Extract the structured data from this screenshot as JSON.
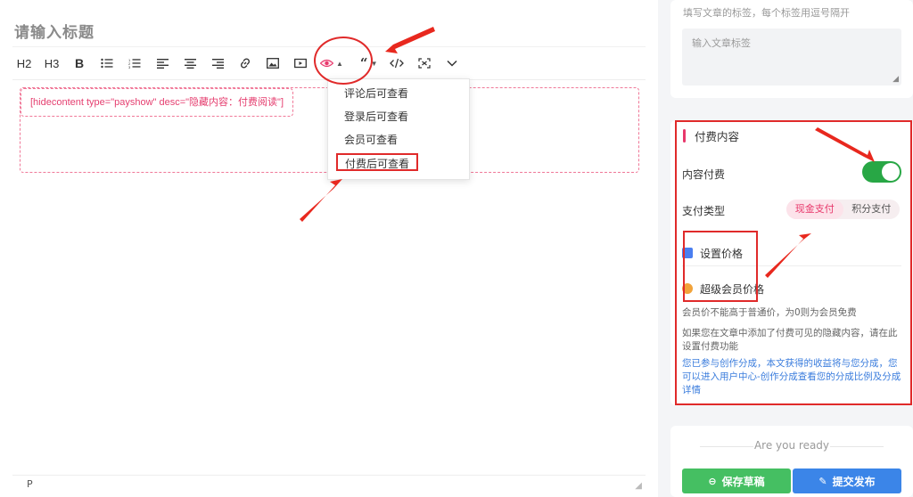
{
  "editor": {
    "title_placeholder": "请输入标题",
    "toolbar": {
      "h2": "H2",
      "h3": "H3",
      "bold": "B",
      "icons": [
        "unordered-list-icon",
        "ordered-list-icon",
        "align-left-icon",
        "align-center-icon",
        "align-right-icon",
        "link-icon",
        "image-icon",
        "video-icon",
        "eye-icon",
        "quote-icon",
        "code-icon",
        "fullscreen-icon",
        "more-icon"
      ]
    },
    "shortcode": "[hidecontent type=\"payshow\" desc=\"隐藏内容：付费阅读\"]",
    "dropdown": [
      "评论后可查看",
      "登录后可查看",
      "会员可查看",
      "付费后可查看"
    ],
    "selected_option": "付费后可查看",
    "status_path": "P"
  },
  "sidebar": {
    "tags": {
      "hint": "填写文章的标签，每个标签用逗号隔开",
      "placeholder": "输入文章标签"
    },
    "paid": {
      "title": "付费内容",
      "content_paid_label": "内容付费",
      "content_paid_on": true,
      "pay_type_label": "支付类型",
      "pay_types": [
        "现金支付",
        "积分支付"
      ],
      "active_pay_type": "现金支付",
      "set_price": "设置价格",
      "vip_price": "超级会员价格",
      "note1": "会员价不能高于普通价，为0则为会员免费",
      "note2": "如果您在文章中添加了付费可见的隐藏内容，请在此设置付费功能",
      "note3": "您已参与创作分成，本文获得的收益将与您分成，您可以进入用户中心-创作分成查看您的分成比例及分成详情"
    },
    "submit": {
      "ready": "Are you ready",
      "save_draft": "保存草稿",
      "publish": "提交发布"
    }
  },
  "colors": {
    "accent": "#e8386b",
    "annotation": "#e02a2a",
    "toggle_on": "#28a745",
    "draft_button": "#45bf62",
    "publish_button": "#3b85e8",
    "link_text": "#3b7ddd"
  }
}
